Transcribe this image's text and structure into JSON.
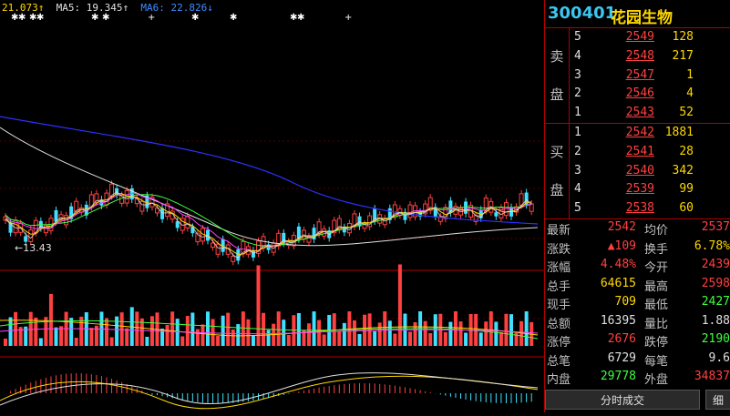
{
  "ma_legend": [
    {
      "text": "21.073↑",
      "color": "#ffd800"
    },
    {
      "text": "MA5: 19.345↑",
      "color": "#e0e0e0"
    },
    {
      "text": "MA6: 22.826↓",
      "color": "#3c8cff"
    }
  ],
  "low_marker": "←13.43",
  "stock": {
    "code": "300401",
    "name": "花园生物"
  },
  "sell_label": [
    "卖",
    "盘"
  ],
  "buy_label": [
    "买",
    "盘"
  ],
  "sell_orders": [
    {
      "level": "5",
      "price": "2549",
      "vol": "128"
    },
    {
      "level": "4",
      "price": "2548",
      "vol": "217"
    },
    {
      "level": "3",
      "price": "2547",
      "vol": "1"
    },
    {
      "level": "2",
      "price": "2546",
      "vol": "4"
    },
    {
      "level": "1",
      "price": "2543",
      "vol": "52"
    }
  ],
  "buy_orders": [
    {
      "level": "1",
      "price": "2542",
      "vol": "1881"
    },
    {
      "level": "2",
      "price": "2541",
      "vol": "28"
    },
    {
      "level": "3",
      "price": "2540",
      "vol": "342"
    },
    {
      "level": "4",
      "price": "2539",
      "vol": "99"
    },
    {
      "level": "5",
      "price": "2538",
      "vol": "60"
    }
  ],
  "stats": [
    {
      "k": "最新",
      "v": "2542",
      "vc": "red",
      "k2": "均价",
      "v2": "2537",
      "v2c": "red"
    },
    {
      "k": "涨跌",
      "v": "▲109",
      "vc": "red",
      "k2": "换手",
      "v2": "6.78%",
      "v2c": "yel"
    },
    {
      "k": "涨幅",
      "v": "4.48%",
      "vc": "red",
      "k2": "今开",
      "v2": "2439",
      "v2c": "red"
    },
    {
      "k": "总手",
      "v": "64615",
      "vc": "yel",
      "k2": "最高",
      "v2": "2598",
      "v2c": "red"
    },
    {
      "k": "现手",
      "v": "709",
      "vc": "yel",
      "k2": "最低",
      "v2": "2427",
      "v2c": "grn"
    },
    {
      "k": "总额",
      "v": "16395",
      "vc": "wht",
      "k2": "量比",
      "v2": "1.88",
      "v2c": "wht"
    },
    {
      "k": "涨停",
      "v": "2676",
      "vc": "red",
      "k2": "跌停",
      "v2": "2190",
      "v2c": "grn"
    },
    {
      "k": "总笔",
      "v": "6729",
      "vc": "wht",
      "k2": "每笔",
      "v2": "9.6",
      "v2c": "wht"
    },
    {
      "k": "内盘",
      "v": "29778",
      "vc": "grn",
      "k2": "外盘",
      "v2": "34837",
      "v2c": "red"
    }
  ],
  "tabs": {
    "timeshare": "分时成交",
    "detail": "细"
  },
  "colors": {
    "up": "#ff4040",
    "down": "#40e0ff",
    "grid": "#b00000",
    "ma1": "#e0e0e0",
    "ma2": "#ffd800",
    "ma3": "#ff40ff",
    "ma4": "#40ff40",
    "ma5": "#3030ff"
  }
}
